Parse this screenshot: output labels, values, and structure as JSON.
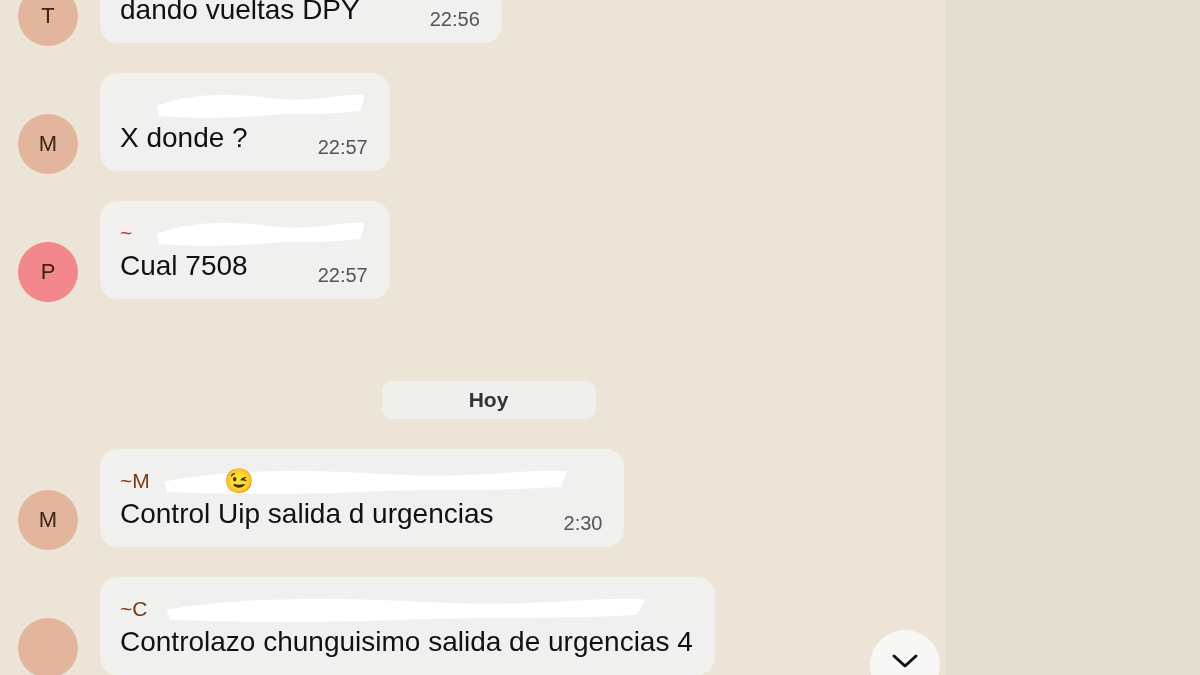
{
  "messages": [
    {
      "kind": "message",
      "avatar": {
        "letter": "T",
        "color": "#e3b59c"
      },
      "text": "dando vueltas  DPY",
      "time": "22:56"
    },
    {
      "kind": "message",
      "avatar": {
        "letter": "M",
        "color": "#e3b59c"
      },
      "text": "X donde ?",
      "time": "22:57"
    },
    {
      "kind": "message",
      "avatar": {
        "letter": "P",
        "color": "#f2888c"
      },
      "sender": {
        "name": "~",
        "color": "#d92b2b"
      },
      "text": "Cual 7508",
      "time": "22:57"
    },
    {
      "kind": "date",
      "text": "Hoy"
    },
    {
      "kind": "message",
      "avatar": {
        "letter": "M",
        "color": "#e3b59c"
      },
      "sender": {
        "name": "~M",
        "emoji": "😉",
        "color": "#7a3b12"
      },
      "text": "Control Uip salida d urgencias",
      "time": "2:30"
    },
    {
      "kind": "message",
      "avatar": {
        "color": "#e3b59c"
      },
      "sender": {
        "name": "~C",
        "color": "#7a3b12"
      },
      "text": "Controlazo chunguisimo salida de urgencias 4"
    }
  ]
}
